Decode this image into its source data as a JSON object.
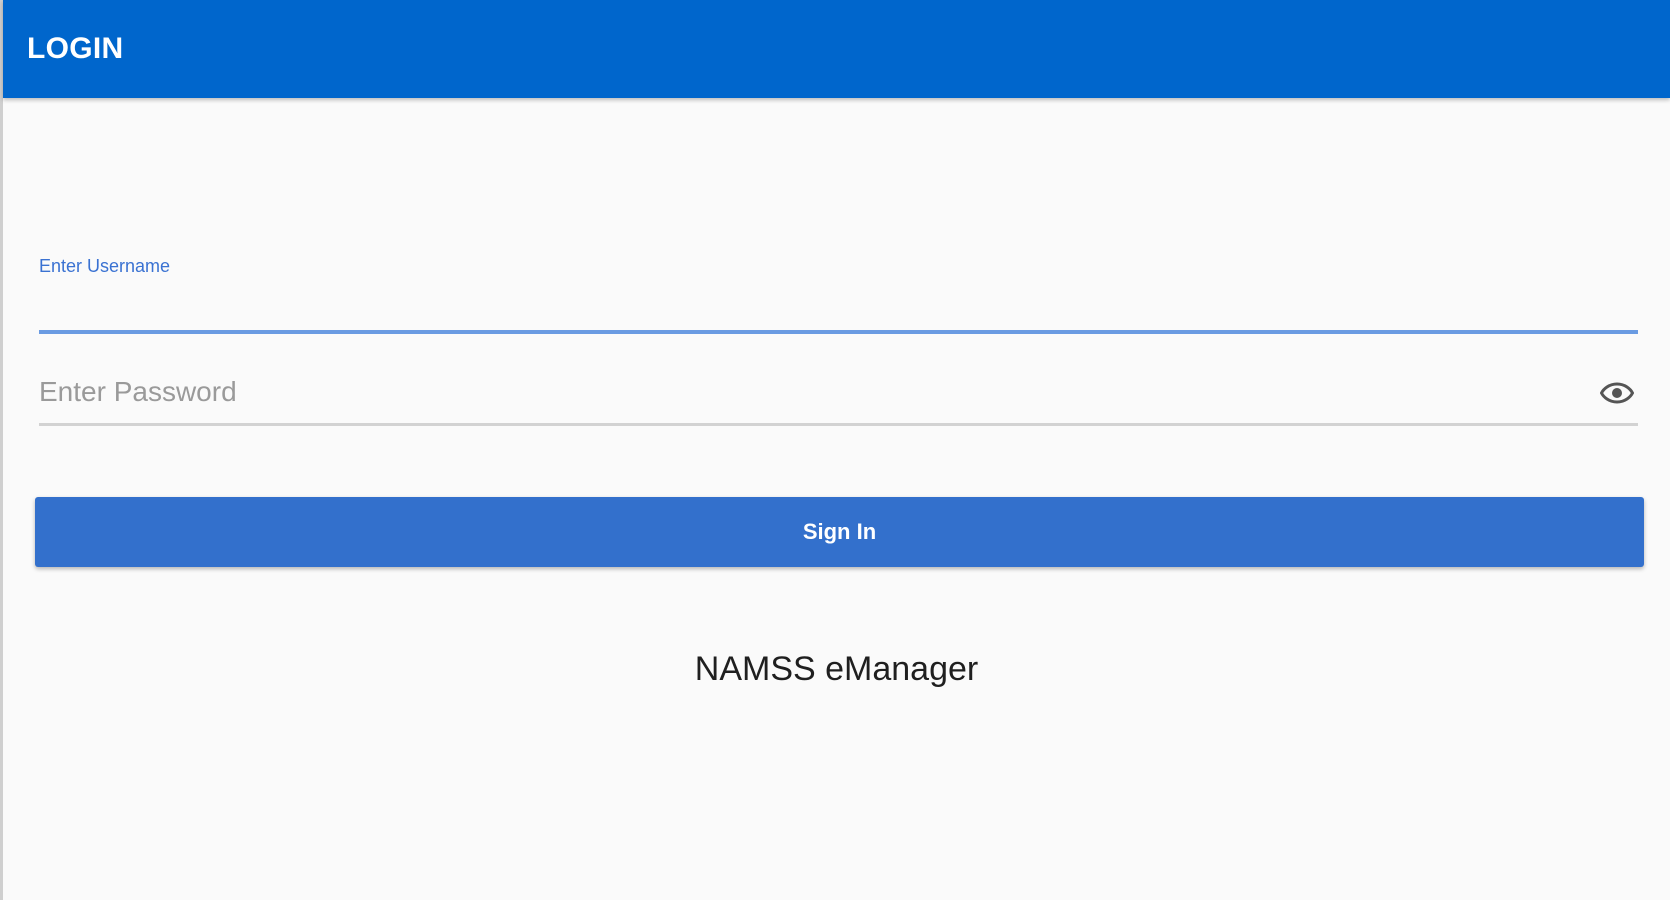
{
  "app_bar": {
    "title": "LOGIN",
    "color": "#0066cc"
  },
  "form": {
    "username": {
      "label": "Enter Username",
      "value": ""
    },
    "password": {
      "placeholder": "Enter Password",
      "value": "",
      "toggle_icon": "eye-icon"
    },
    "sign_in_label": "Sign In",
    "button_color": "#3370cc"
  },
  "footer": {
    "brand": "NAMSS eManager"
  }
}
